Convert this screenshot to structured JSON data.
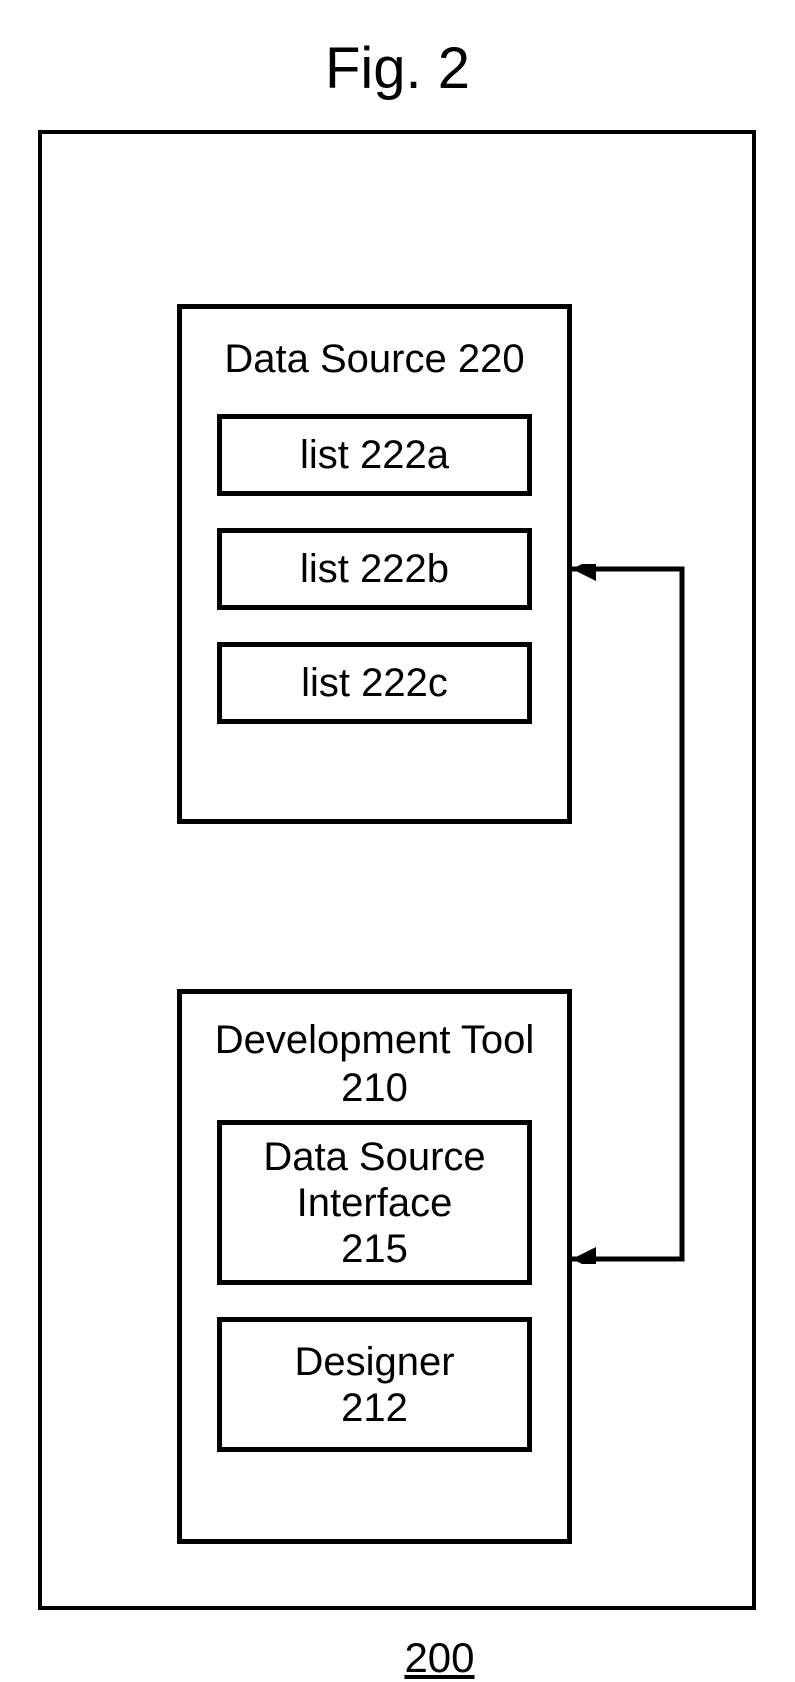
{
  "figure": {
    "title": "Fig. 2",
    "number": "200"
  },
  "dataSource": {
    "title": "Data Source 220",
    "lists": [
      "list 222a",
      "list 222b",
      "list 222c"
    ]
  },
  "developmentTool": {
    "title_line1": "Development Tool",
    "title_line2": "210",
    "interface_line1": "Data Source",
    "interface_line2": "Interface",
    "interface_line3": "215",
    "designer_line1": "Designer",
    "designer_line2": "212"
  }
}
